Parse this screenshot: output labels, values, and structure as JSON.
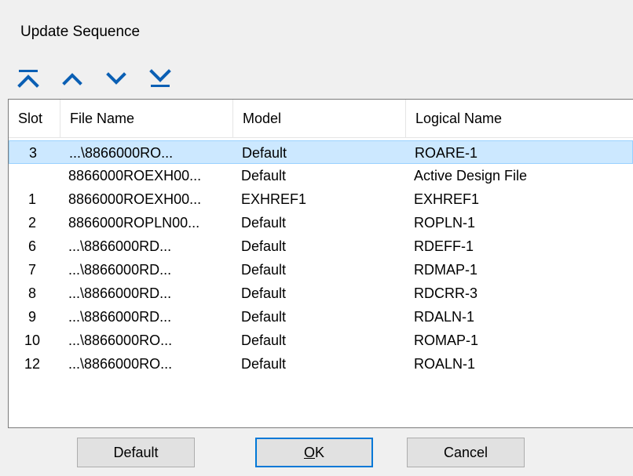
{
  "dialog": {
    "title": "Update Sequence"
  },
  "toolbar": {
    "icons": [
      "move-to-top-icon",
      "move-up-icon",
      "move-down-icon",
      "move-to-bottom-icon"
    ],
    "icon_color": "#0a5fb4"
  },
  "list": {
    "columns": [
      "Slot",
      "File Name",
      "Model",
      "Logical Name"
    ],
    "selection_color": "#cce8ff",
    "rows": [
      {
        "slot": "3",
        "file": "...\\8866000RO...",
        "model": "Default",
        "logical": "ROARE-1",
        "selected": true
      },
      {
        "slot": "",
        "file": "8866000ROEXH00...",
        "model": "Default",
        "logical": "Active Design File"
      },
      {
        "slot": "1",
        "file": "8866000ROEXH00...",
        "model": "EXHREF1",
        "logical": "EXHREF1"
      },
      {
        "slot": "2",
        "file": "8866000ROPLN00...",
        "model": "Default",
        "logical": "ROPLN-1"
      },
      {
        "slot": "6",
        "file": "...\\8866000RD...",
        "model": "Default",
        "logical": "RDEFF-1"
      },
      {
        "slot": "7",
        "file": "...\\8866000RD...",
        "model": "Default",
        "logical": "RDMAP-1"
      },
      {
        "slot": "8",
        "file": "...\\8866000RD...",
        "model": "Default",
        "logical": "RDCRR-3"
      },
      {
        "slot": "9",
        "file": "...\\8866000RD...",
        "model": "Default",
        "logical": "RDALN-1"
      },
      {
        "slot": "10",
        "file": "...\\8866000RO...",
        "model": "Default",
        "logical": "ROMAP-1"
      },
      {
        "slot": "12",
        "file": "...\\8866000RO...",
        "model": "Default",
        "logical": "ROALN-1"
      }
    ]
  },
  "buttons": {
    "default_label": "Default",
    "ok_label": "OK",
    "ok_mnemonic": "O",
    "ok_rest": "K",
    "cancel_label": "Cancel"
  }
}
